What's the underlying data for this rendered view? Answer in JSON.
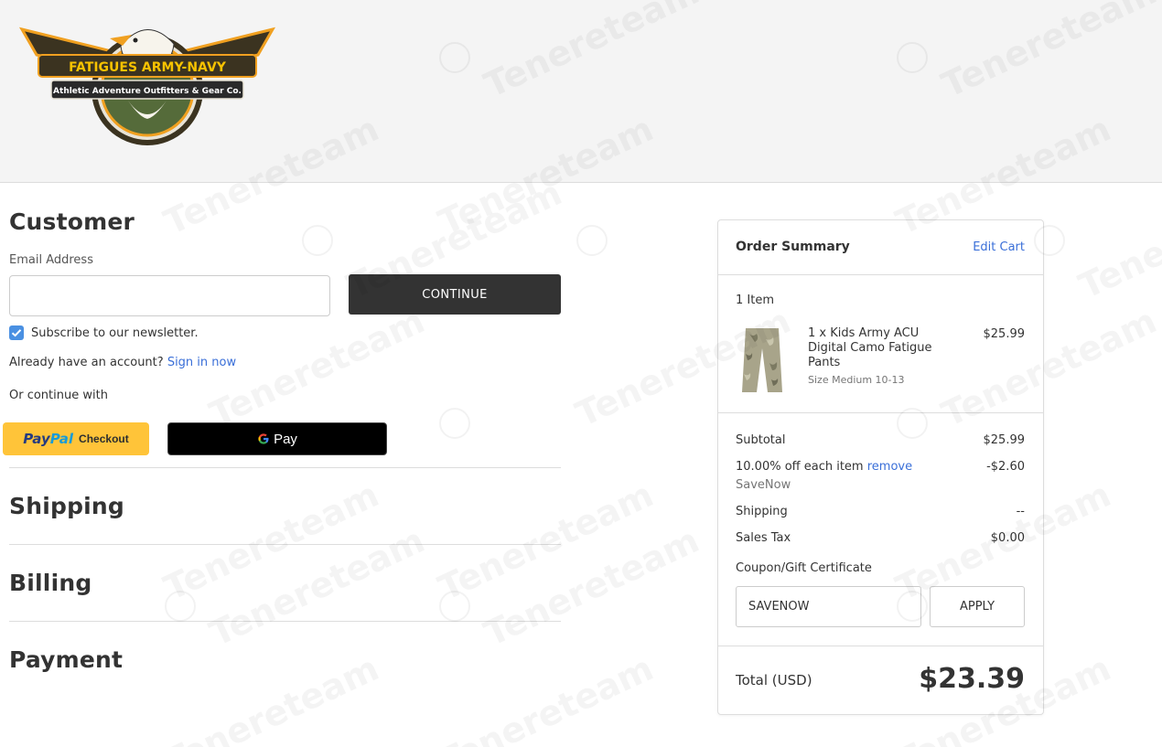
{
  "header": {
    "logo_title": "FATIGUES ARMY-NAVY",
    "logo_subtitle": "Athletic Adventure Outfitters & Gear Co."
  },
  "customer": {
    "title": "Customer",
    "email_label": "Email Address",
    "email_value": "",
    "continue_label": "CONTINUE",
    "newsletter_label": "Subscribe to our newsletter.",
    "newsletter_checked": true,
    "account_prompt": "Already have an account?",
    "sign_in_label": "Sign in now",
    "or_continue": "Or continue with",
    "paypal_pay": "Pay",
    "paypal_pal": "Pal",
    "paypal_checkout": "Checkout",
    "gpay_label": "Pay"
  },
  "sections": {
    "shipping": "Shipping",
    "billing": "Billing",
    "payment": "Payment"
  },
  "summary": {
    "title": "Order Summary",
    "edit_cart": "Edit Cart",
    "item_count": "1 Item",
    "item": {
      "name_line1": "1 x Kids Army ACU",
      "name_line2": "Digital Camo Fatigue",
      "name_line3": "Pants",
      "option": "Size Medium 10-13",
      "price": "$25.99"
    },
    "subtotal_label": "Subtotal",
    "subtotal_value": "$25.99",
    "discount_label": "10.00% off each item",
    "discount_remove": "remove",
    "discount_code": "SaveNow",
    "discount_value": "-$2.60",
    "shipping_label": "Shipping",
    "shipping_value": "--",
    "tax_label": "Sales Tax",
    "tax_value": "$0.00",
    "coupon_label": "Coupon/Gift Certificate",
    "coupon_value": "SAVENOW",
    "apply_label": "APPLY",
    "total_label": "Total (USD)",
    "total_value": "$23.39"
  },
  "watermark_text": "Tenereteam"
}
